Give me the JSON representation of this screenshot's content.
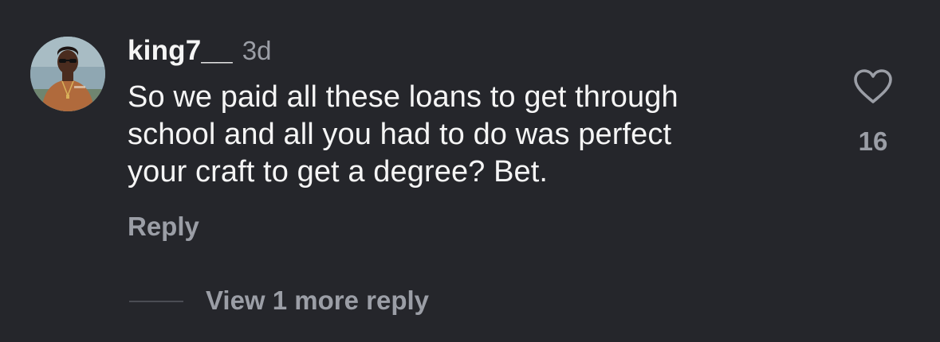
{
  "comment": {
    "username": "king7__",
    "timestamp": "3d",
    "lines": [
      "So we paid all these loans to get through",
      "school and all you had to do was perfect",
      "your craft to get a degree? Bet."
    ],
    "reply_label": "Reply",
    "like_count": "16",
    "like_icon": "heart-outline-icon",
    "view_replies_label": "View 1 more reply"
  },
  "colors": {
    "background": "#25262b",
    "primary_text": "#f5f5f5",
    "secondary_text": "#9b9ea6"
  }
}
